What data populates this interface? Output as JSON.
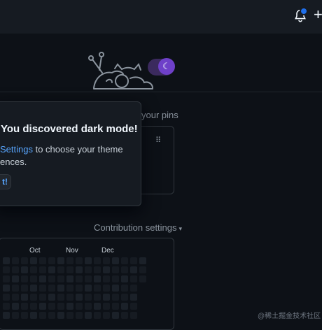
{
  "header": {
    "notification_icon": "bell-icon",
    "new_icon": "plus-icon",
    "new_label": "+"
  },
  "theme_toggle": {
    "icon": "moon-icon",
    "glyph": "☾",
    "mode": "dark"
  },
  "pins": {
    "text": "your pins",
    "drag_icon": "grip-icon"
  },
  "popover": {
    "title": "You discovered dark mode!",
    "line1_link": "Settings",
    "line1_rest": " to choose your theme",
    "line2": "ences.",
    "button_label": "t!"
  },
  "contributions": {
    "settings_label": "Contribution settings",
    "caret": "▾",
    "months": [
      "Oct",
      "Nov",
      "Dec"
    ]
  },
  "watermark": "@稀土掘金技术社区",
  "colors": {
    "background": "#0d1117",
    "accent": "#58a6ff",
    "toggle": "#6e40c9",
    "notification_dot": "#1f6feb"
  }
}
